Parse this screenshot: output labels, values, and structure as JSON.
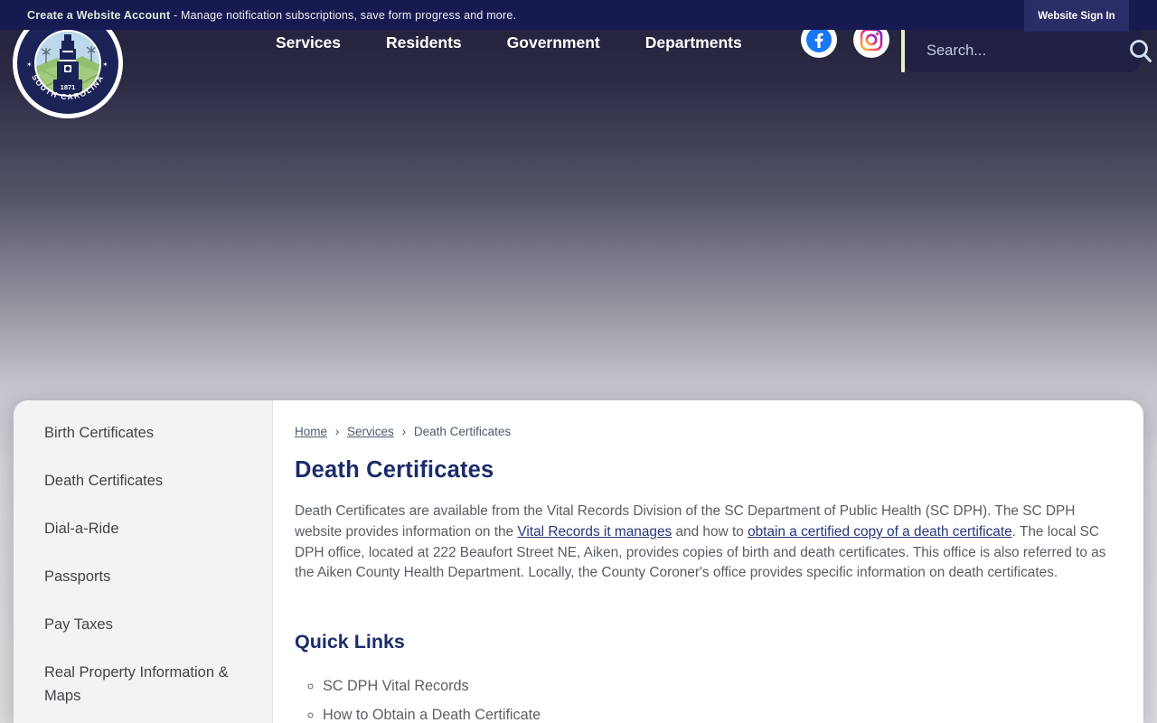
{
  "topbar": {
    "promo_link": "Create a Website Account",
    "promo_rest": " - Manage notification subscriptions, save form progress and more.",
    "signin_label": "Website Sign In"
  },
  "header": {
    "nav": [
      {
        "label": "Services"
      },
      {
        "label": "Residents"
      },
      {
        "label": "Government"
      },
      {
        "label": "Departments"
      }
    ],
    "search_placeholder": "Search...",
    "social": [
      {
        "name": "facebook"
      },
      {
        "name": "instagram"
      }
    ],
    "logo": {
      "state": "SOUTH CAROLINA",
      "year": "1871"
    }
  },
  "sidebar": {
    "items": [
      "Birth Certificates",
      "Death Certificates",
      "Dial-a-Ride",
      "Passports",
      "Pay Taxes",
      "Real Property Information & Maps"
    ]
  },
  "main": {
    "breadcrumb": [
      {
        "label": "Home"
      },
      {
        "label": "Services"
      },
      {
        "label": "Death Certificates"
      }
    ],
    "breadcrumb_sep": "›",
    "title": "Death Certificates",
    "intro": {
      "seg1": "Death Certificates are available from the Vital Records Division of the SC Department of Public Health (SC DPH). The SC DPH website provides information on the ",
      "link1": "Vital Records it manages",
      "seg2": " and how to ",
      "link2": "obtain a certified copy of a death certificate",
      "seg3": ". The local SC DPH office, located at 222 Beaufort Street NE, Aiken, provides copies of birth and death certificates. This office is also referred to as the Aiken County Health Department. Locally, the County Coroner's office provides specific information on death certificates."
    },
    "quick_links_title": "Quick Links",
    "quick_links": [
      "SC DPH Vital Records",
      "How to Obtain a Death Certificate"
    ]
  },
  "colors": {
    "topbar_bg": "#161a50",
    "signin_bg": "#2a2d68",
    "search_bg": "#1f2043",
    "search_divider": "#e9eecb",
    "navy_heading": "#1c2c6b",
    "body_text": "#585d63",
    "sidebar_bg": "#f4f3f3",
    "facebook_blue": "#1877f2"
  }
}
